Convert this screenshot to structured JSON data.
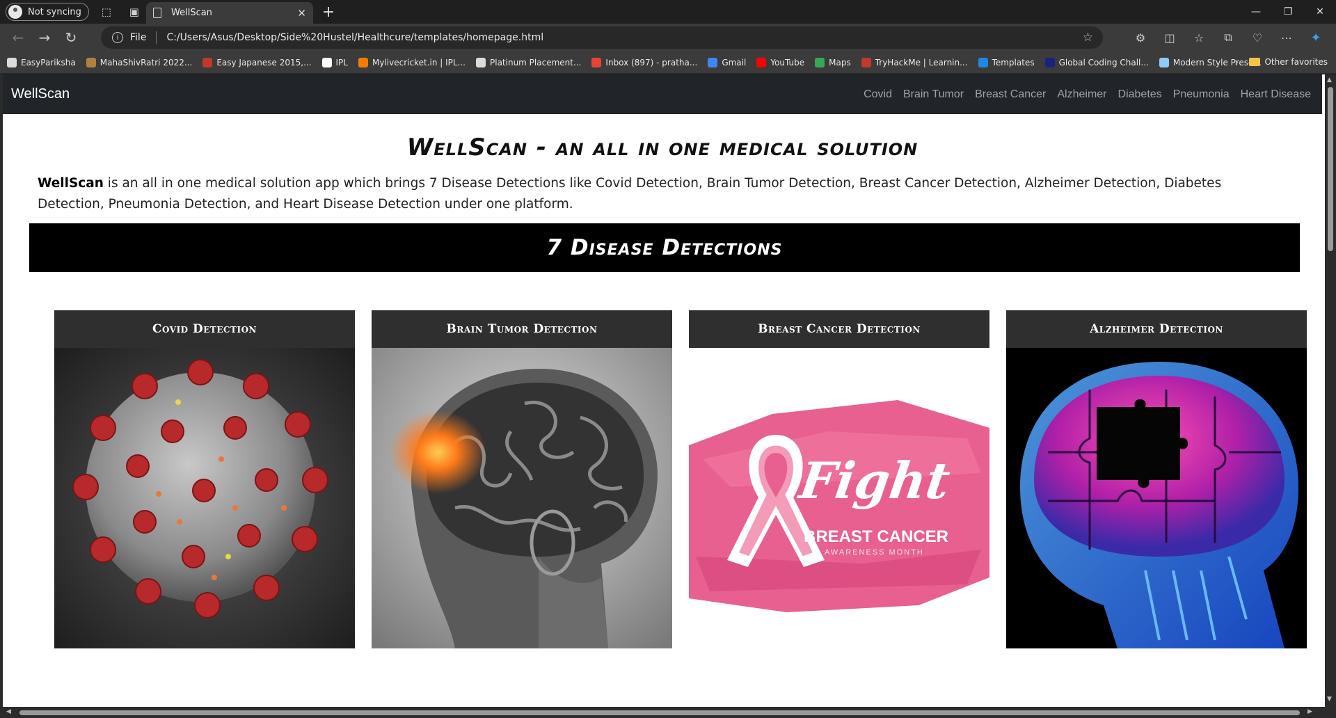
{
  "browser": {
    "profile_label": "Not syncing",
    "tab_title": "WellScan",
    "url_scheme": "File",
    "url": "C:/Users/Asus/Desktop/Side%20Hustel/Healthcure/templates/homepage.html",
    "bookmarks": [
      {
        "label": "EasyPariksha",
        "icon": "page-icon",
        "color": "#dcdcdc"
      },
      {
        "label": "MahaShivRatri 2022...",
        "icon": "figure-icon",
        "color": "#b08040"
      },
      {
        "label": "Easy Japanese 2015,...",
        "icon": "calendar-icon",
        "color": "#c0392b"
      },
      {
        "label": "IPL",
        "icon": "page-icon",
        "color": "#ffffff"
      },
      {
        "label": "Mylivecricket.in | IPL...",
        "icon": "blogger-icon",
        "color": "#f57c00"
      },
      {
        "label": "Platinum Placement...",
        "icon": "page-icon",
        "color": "#dcdcdc"
      },
      {
        "label": "Inbox (897) - pratha...",
        "icon": "gmail-icon",
        "color": "#ea4335"
      },
      {
        "label": "Gmail",
        "icon": "google-icon",
        "color": "#4285f4"
      },
      {
        "label": "YouTube",
        "icon": "youtube-icon",
        "color": "#ff0000"
      },
      {
        "label": "Maps",
        "icon": "maps-icon",
        "color": "#34a853"
      },
      {
        "label": "TryHackMe | Learnin...",
        "icon": "tryhackme-icon",
        "color": "#c0392b"
      },
      {
        "label": "Templates",
        "icon": "templates-icon",
        "color": "#1e88e5"
      },
      {
        "label": "Global Coding Chall...",
        "icon": "coding-icon",
        "color": "#1a237e"
      },
      {
        "label": "Modern Style Prese...",
        "icon": "presentation-icon",
        "color": "#90caf9"
      }
    ],
    "other_favorites": "Other favorites"
  },
  "navbar": {
    "brand": "WellScan",
    "links": [
      "Covid",
      "Brain Tumor",
      "Breast Cancer",
      "Alzheimer",
      "Diabetes",
      "Pneumonia",
      "Heart Disease"
    ]
  },
  "hero": {
    "title": "WellScan - an all in one medical solution",
    "intro_bold": "WellScan",
    "intro_rest": " is an all in one medical solution app which brings 7 Disease Detections like Covid Detection, Brain Tumor Detection, Breast Cancer Detection, Alzheimer Detection, Diabetes Detection, Pneumonia Detection, and Heart Disease Detection under one platform."
  },
  "banner": {
    "title": "7 Disease Detections"
  },
  "cards": [
    {
      "title": "Covid Detection"
    },
    {
      "title": "Brain Tumor Detection"
    },
    {
      "title": "Breast Cancer Detection",
      "image_text_main": "Fight",
      "image_text_sub": "BREAST CANCER",
      "image_text_small": "AWARENESS MONTH"
    },
    {
      "title": "Alzheimer Detection"
    }
  ],
  "colors": {
    "navbar_bg": "#212529",
    "banner_bg": "#000000",
    "card_header_bg": "#2f2f2f",
    "ribbon_pink": "#e8608f"
  }
}
